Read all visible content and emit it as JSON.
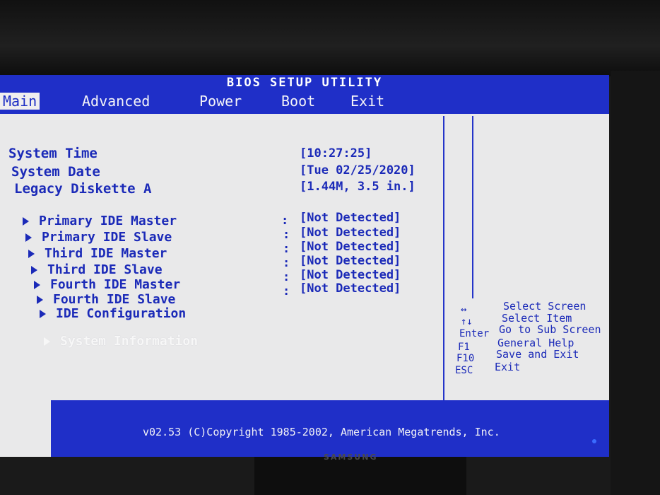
{
  "window": {
    "title": "BIOS SETUP UTILITY"
  },
  "menu": {
    "items": [
      {
        "label": "Main",
        "active": true
      },
      {
        "label": "Advanced",
        "active": false
      },
      {
        "label": "Power",
        "active": false
      },
      {
        "label": "Boot",
        "active": false
      },
      {
        "label": "Exit",
        "active": false
      }
    ]
  },
  "main": {
    "fields": [
      {
        "label": "System Time",
        "value": "[10:27:25]"
      },
      {
        "label": "System Date",
        "value": "[Tue 02/25/2020]"
      },
      {
        "label": "Legacy Diskette A",
        "value": "[1.44M, 3.5 in.]"
      }
    ],
    "ide": [
      {
        "label": "Primary IDE Master",
        "value": "[Not Detected]"
      },
      {
        "label": "Primary IDE Slave",
        "value": "[Not Detected]"
      },
      {
        "label": "Third IDE Master",
        "value": "[Not Detected]"
      },
      {
        "label": "Third IDE Slave",
        "value": "[Not Detected]"
      },
      {
        "label": "Fourth IDE Master",
        "value": "[Not Detected]"
      },
      {
        "label": "Fourth IDE Slave",
        "value": "[Not Detected]"
      }
    ],
    "submenus": [
      {
        "label": "IDE Configuration"
      },
      {
        "label": "System Information"
      }
    ],
    "colon": ":"
  },
  "help": [
    {
      "key": "↔",
      "desc": "Select Screen"
    },
    {
      "key": "↑↓",
      "desc": "Select Item"
    },
    {
      "key": "Enter",
      "desc": "Go to Sub Screen"
    },
    {
      "key": "F1",
      "desc": "General Help"
    },
    {
      "key": "F10",
      "desc": "Save and Exit"
    },
    {
      "key": "ESC",
      "desc": "Exit"
    }
  ],
  "footer": {
    "text": "v02.53 (C)Copyright 1985-2002, American Megatrends, Inc."
  },
  "monitor": {
    "brand": "SAMSUNG"
  },
  "colors": {
    "bios_blue": "#1f2fc8",
    "screen_bg": "#e9e9ea",
    "text_blue": "#1b2ab8"
  }
}
